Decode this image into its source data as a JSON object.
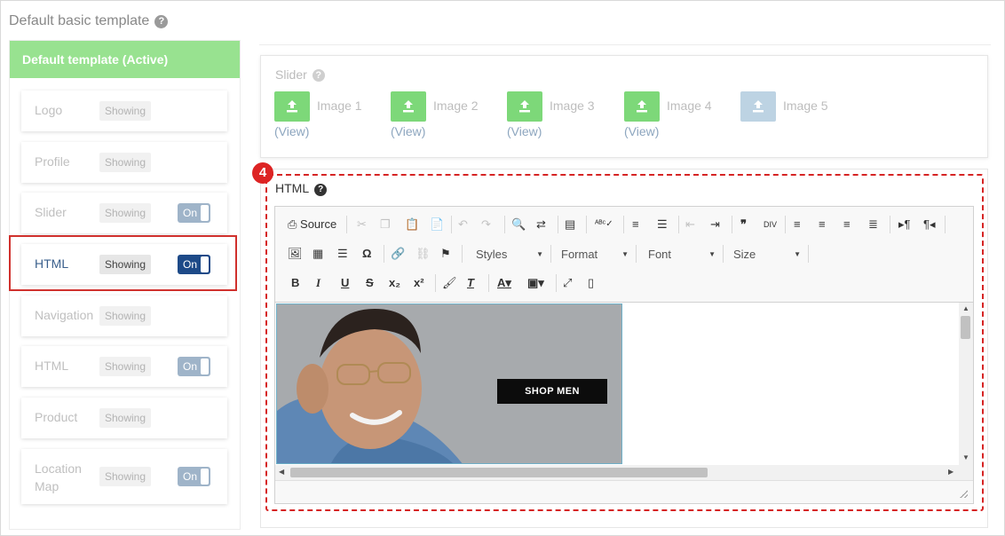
{
  "page_title": "Default basic template",
  "help_glyph": "?",
  "sidebar": {
    "header": "Default template (Active)",
    "items": [
      {
        "label": "Logo",
        "status": "Showing",
        "toggle": null,
        "active": false
      },
      {
        "label": "Profile",
        "status": "Showing",
        "toggle": null,
        "active": false
      },
      {
        "label": "Slider",
        "status": "Showing",
        "toggle": "On",
        "active": false
      },
      {
        "label": "HTML",
        "status": "Showing",
        "toggle": "On",
        "active": true
      },
      {
        "label": "Navigation",
        "status": "Showing",
        "toggle": null,
        "active": false
      },
      {
        "label": "HTML",
        "status": "Showing",
        "toggle": "On",
        "active": false
      },
      {
        "label": "Product",
        "status": "Showing",
        "toggle": null,
        "active": false
      },
      {
        "label": "Location Map",
        "status": "Showing",
        "toggle": "On",
        "active": false
      }
    ]
  },
  "slider": {
    "title": "Slider",
    "images": [
      {
        "label": "Image 1",
        "view": "(View)",
        "enabled": true
      },
      {
        "label": "Image 2",
        "view": "(View)",
        "enabled": true
      },
      {
        "label": "Image 3",
        "view": "(View)",
        "enabled": true
      },
      {
        "label": "Image 4",
        "view": "(View)",
        "enabled": true
      },
      {
        "label": "Image 5",
        "view": "",
        "enabled": false
      }
    ]
  },
  "step_badge": "4",
  "html_section": {
    "title": "HTML",
    "toolbar": {
      "source": "Source",
      "styles": "Styles",
      "format": "Format",
      "font": "Font",
      "size": "Size"
    },
    "banner_cta": "SHOP MEN"
  },
  "colors": {
    "active_header": "#98e290",
    "upload_button": "#7dd879",
    "toggle_active": "#1d4a88",
    "highlight": "#d0312d"
  }
}
